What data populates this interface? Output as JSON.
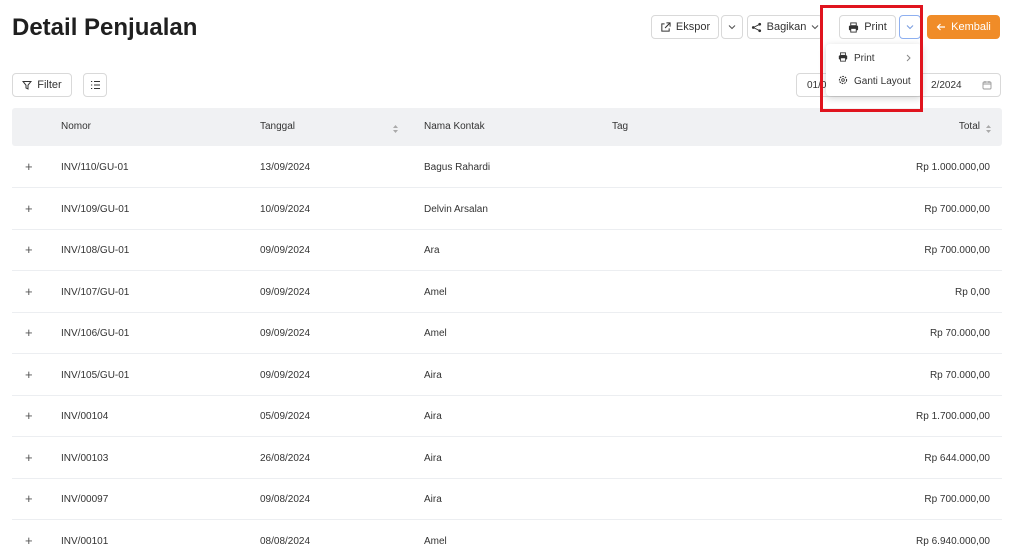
{
  "page": {
    "title": "Detail Penjualan"
  },
  "toolbar": {
    "ekspor": "Ekspor",
    "bagikan": "Bagikan",
    "print": "Print",
    "kembali": "Kembali",
    "filter": "Filter"
  },
  "print_menu": {
    "items": [
      {
        "label": "Print"
      },
      {
        "label": "Ganti Layout"
      }
    ]
  },
  "date_range": {
    "start": "01/0",
    "end": "2/2024"
  },
  "table": {
    "headers": {
      "nomor": "Nomor",
      "tanggal": "Tanggal",
      "kontak": "Nama Kontak",
      "tag": "Tag",
      "total": "Total"
    },
    "rows": [
      {
        "nomor": "INV/110/GU-01",
        "tanggal": "13/09/2024",
        "kontak": "Bagus Rahardi",
        "total": "Rp 1.000.000,00"
      },
      {
        "nomor": "INV/109/GU-01",
        "tanggal": "10/09/2024",
        "kontak": "Delvin Arsalan",
        "total": "Rp 700.000,00"
      },
      {
        "nomor": "INV/108/GU-01",
        "tanggal": "09/09/2024",
        "kontak": "Ara",
        "total": "Rp 700.000,00"
      },
      {
        "nomor": "INV/107/GU-01",
        "tanggal": "09/09/2024",
        "kontak": "Amel",
        "total": "Rp 0,00"
      },
      {
        "nomor": "INV/106/GU-01",
        "tanggal": "09/09/2024",
        "kontak": "Amel",
        "total": "Rp 70.000,00"
      },
      {
        "nomor": "INV/105/GU-01",
        "tanggal": "09/09/2024",
        "kontak": "Aira",
        "total": "Rp 70.000,00"
      },
      {
        "nomor": "INV/00104",
        "tanggal": "05/09/2024",
        "kontak": "Aira",
        "total": "Rp 1.700.000,00"
      },
      {
        "nomor": "INV/00103",
        "tanggal": "26/08/2024",
        "kontak": "Aira",
        "total": "Rp 644.000,00"
      },
      {
        "nomor": "INV/00097",
        "tanggal": "09/08/2024",
        "kontak": "Aira",
        "total": "Rp 700.000,00"
      },
      {
        "nomor": "INV/00101",
        "tanggal": "08/08/2024",
        "kontak": "Amel",
        "total": "Rp 6.940.000,00"
      }
    ]
  },
  "colors": {
    "accent": "#f08c28",
    "highlight": "#e0141e",
    "header_bg": "#f0f1f3"
  },
  "icons": [
    "export-icon",
    "share-icon",
    "printer-icon",
    "chevron-down-icon",
    "arrow-left-icon",
    "filter-icon",
    "list-icon",
    "settings-icon",
    "chevron-right-icon",
    "calendar-icon",
    "sort-icon",
    "plus-icon"
  ]
}
